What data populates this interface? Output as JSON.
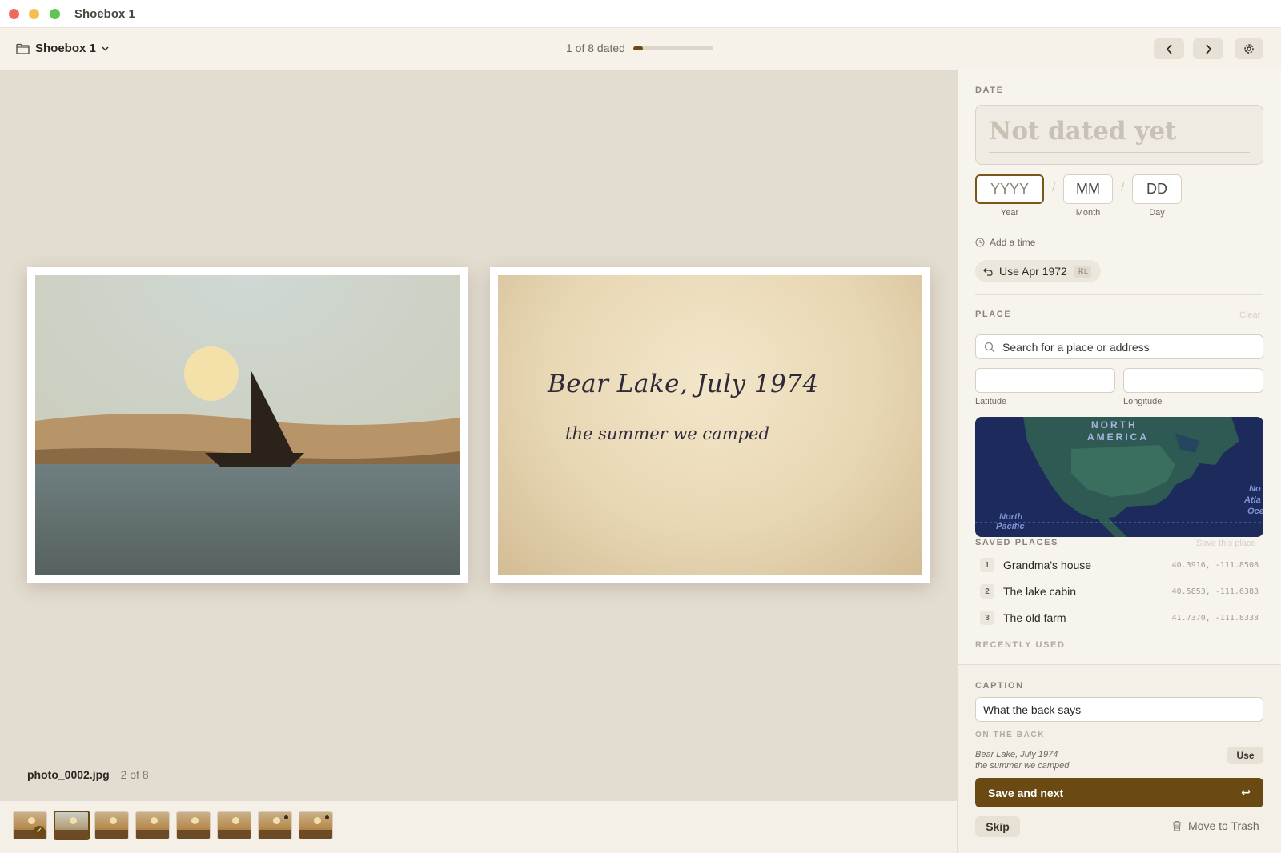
{
  "window": {
    "title": "Shoebox 1"
  },
  "toolbar": {
    "folder_label": "Shoebox 1",
    "progress_text": "1 of 8 dated",
    "progress_fraction": 0.125,
    "prev_icon": "chevron-left-icon",
    "next_icon": "chevron-right-icon",
    "settings_icon": "gear-icon"
  },
  "photo": {
    "filename": "photo_0002.jpg",
    "position": "2 of 8",
    "back_line1": "Bear Lake, July 1974",
    "back_line2": "the summer we camped"
  },
  "filmstrip": {
    "count": 8,
    "selected_index": 1,
    "dated_index": 0
  },
  "date": {
    "section_label": "DATE",
    "display_placeholder": "Not dated yet",
    "year_placeholder": "YYYY",
    "month_placeholder": "MM",
    "day_placeholder": "DD",
    "year_label": "Year",
    "month_label": "Month",
    "day_label": "Day",
    "separator": "/",
    "add_time": "Add a time",
    "suggestion": "Use Apr 1972",
    "suggestion_shortcut": "⌘L"
  },
  "place": {
    "section_label": "PLACE",
    "clear_label": "Clear",
    "search_placeholder": "Search for a place or address",
    "latitude_label": "Latitude",
    "longitude_label": "Longitude",
    "map_continent_1": "NORTH",
    "map_continent_2": "AMERICA",
    "map_ocean_1": "North",
    "map_ocean_2": "Pacific",
    "map_ocean_east_1": "No",
    "map_ocean_east_2": "Atla",
    "map_ocean_east_3": "Oce"
  },
  "saved_places": {
    "section_label": "SAVED PLACES",
    "save_label": "Save this place",
    "items": [
      {
        "num": "1",
        "name": "Grandma's house",
        "coords": "40.3916, -111.8508"
      },
      {
        "num": "2",
        "name": "The lake cabin",
        "coords": "40.5853, -111.6383"
      },
      {
        "num": "3",
        "name": "The old farm",
        "coords": "41.7370, -111.8338"
      }
    ],
    "recent_label": "RECENTLY USED"
  },
  "caption": {
    "section_label": "CAPTION",
    "placeholder": "What the back says",
    "on_back_label": "ON THE BACK",
    "back_line1": "Bear Lake, July 1974",
    "back_line2": "the summer we camped",
    "use_label": "Use"
  },
  "actions": {
    "save_next": "Save and next",
    "save_shortcut": "↩",
    "skip": "Skip",
    "trash": "Move to Trash"
  },
  "colors": {
    "accent": "#6a4a12",
    "map": "#1c2a5c"
  }
}
